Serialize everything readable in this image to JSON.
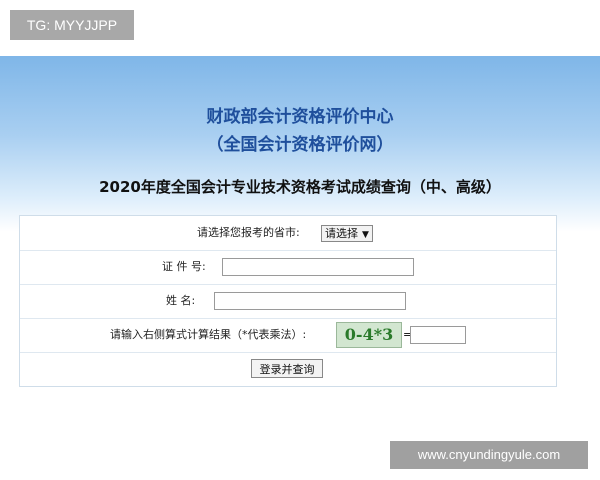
{
  "watermarks": {
    "top_left": "TG: MYYJJPP",
    "bottom_right": "www.cnyundingyule.com"
  },
  "header": {
    "org_name": "财政部会计资格评价中心",
    "org_subtitle": "（全国会计资格评价网）",
    "exam_title": "2020年度全国会计专业技术资格考试成绩查询（中、高级）"
  },
  "form": {
    "province_label": "请选择您报考的省市:",
    "province_select": "请选择",
    "id_label": "证 件 号:",
    "id_value": "",
    "name_label": "姓  名:",
    "name_value": "",
    "captcha_label": "请输入右侧算式计算结果（*代表乘法）:",
    "captcha_text": "0-4*3",
    "equals": "=",
    "captcha_value": "",
    "submit_label": "登录并查询"
  }
}
